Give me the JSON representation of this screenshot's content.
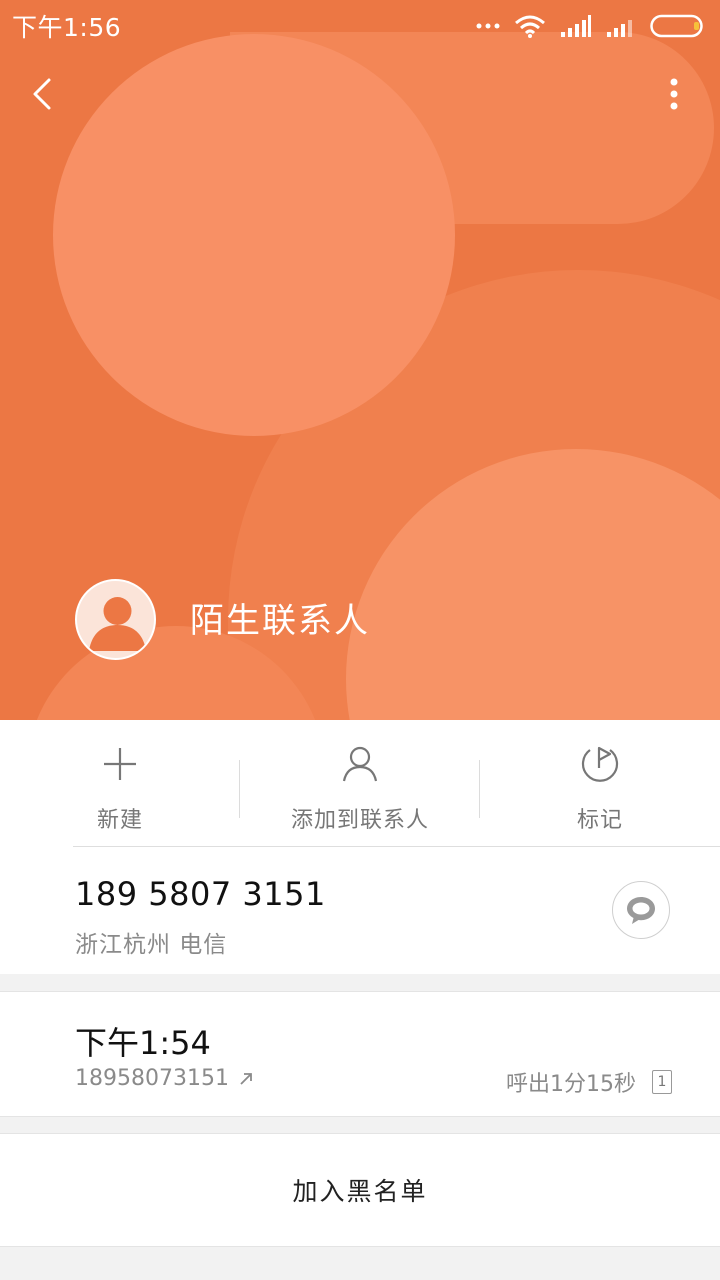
{
  "status_bar": {
    "time": "下午1:56"
  },
  "contact": {
    "name": "陌生联系人"
  },
  "actions": [
    {
      "label": "新建",
      "icon": "plus-icon"
    },
    {
      "label": "添加到联系人",
      "icon": "person-icon"
    },
    {
      "label": "标记",
      "icon": "flag-icon"
    }
  ],
  "phone": {
    "number": "189 5807 3151",
    "location": "浙江杭州 电信"
  },
  "call_log": {
    "time": "下午1:54",
    "number": "18958073151",
    "detail": "呼出1分15秒",
    "sim": "1"
  },
  "blacklist": {
    "label": "加入黑名单"
  },
  "colors": {
    "header": "#ec7744",
    "accent_light": "#f89065"
  }
}
